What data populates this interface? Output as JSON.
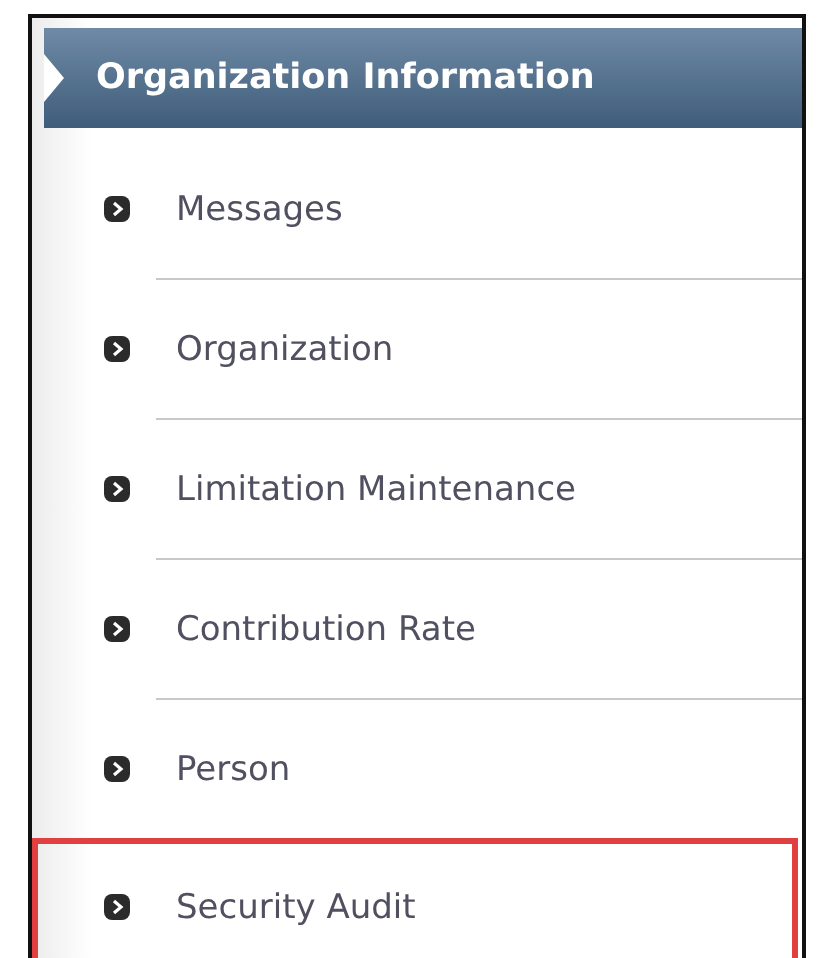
{
  "header": {
    "title": "Organization Information"
  },
  "menu_items": [
    {
      "label": "Messages",
      "highlighted": false
    },
    {
      "label": "Organization",
      "highlighted": false
    },
    {
      "label": "Limitation Maintenance",
      "highlighted": false
    },
    {
      "label": "Contribution Rate",
      "highlighted": false
    },
    {
      "label": "Person",
      "highlighted": false
    },
    {
      "label": "Security Audit",
      "highlighted": true
    }
  ]
}
